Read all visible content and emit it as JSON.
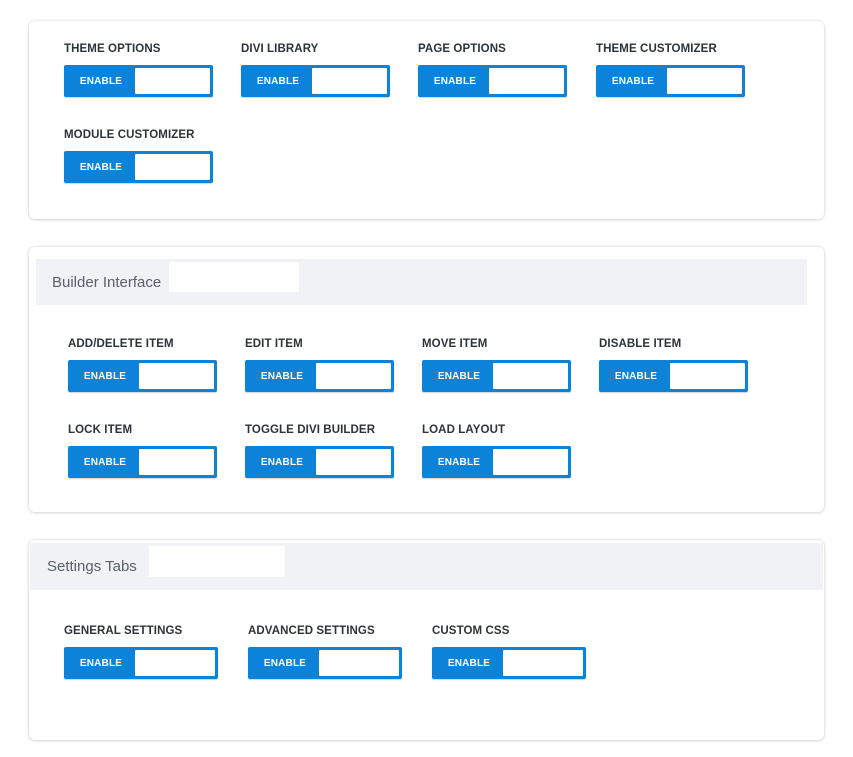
{
  "sections": {
    "theme": {
      "title": "",
      "items": [
        {
          "label": "THEME OPTIONS",
          "state": "ENABLE"
        },
        {
          "label": "DIVI LIBRARY",
          "state": "ENABLE"
        },
        {
          "label": "PAGE OPTIONS",
          "state": "ENABLE"
        },
        {
          "label": "THEME CUSTOMIZER",
          "state": "ENABLE"
        },
        {
          "label": "MODULE CUSTOMIZER",
          "state": "ENABLE"
        }
      ]
    },
    "builder": {
      "title": "Builder Interface",
      "items": [
        {
          "label": "ADD/DELETE ITEM",
          "state": "ENABLE"
        },
        {
          "label": "EDIT ITEM",
          "state": "ENABLE"
        },
        {
          "label": "MOVE ITEM",
          "state": "ENABLE"
        },
        {
          "label": "DISABLE ITEM",
          "state": "ENABLE"
        },
        {
          "label": "LOCK ITEM",
          "state": "ENABLE"
        },
        {
          "label": "TOGGLE DIVI BUILDER",
          "state": "ENABLE"
        },
        {
          "label": "LOAD LAYOUT",
          "state": "ENABLE"
        }
      ]
    },
    "settings": {
      "title": "Settings Tabs",
      "items": [
        {
          "label": "GENERAL SETTINGS",
          "state": "ENABLE"
        },
        {
          "label": "ADVANCED SETTINGS",
          "state": "ENABLE"
        },
        {
          "label": "CUSTOM CSS",
          "state": "ENABLE"
        }
      ]
    }
  },
  "colors": {
    "toggle_on": "#0c83d8",
    "header_bg": "#f0f2f5",
    "label_text": "#2e3338",
    "header_text": "#59606b"
  }
}
